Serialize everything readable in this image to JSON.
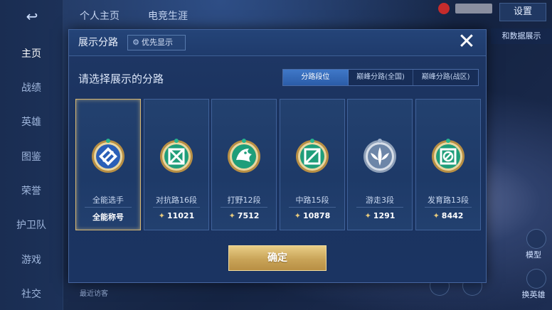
{
  "background": {
    "top_nav": [
      "个人主页",
      "电竞生涯"
    ],
    "settings_label": "设置",
    "right_peek_label": "和数据展示",
    "sidebar_items": [
      "主页",
      "战绩",
      "英雄",
      "图鉴",
      "荣誉",
      "护卫队",
      "游戏",
      "社交"
    ],
    "bottom_right_labels": [
      "模型",
      "换英雄"
    ],
    "recent_visitors_label": "最近访客"
  },
  "modal": {
    "title": "展示分路",
    "priority_label": "优先显示",
    "subtitle": "请选择展示的分路",
    "tabs": [
      {
        "label": "分路段位",
        "active": true
      },
      {
        "label": "巅峰分路(全国)",
        "active": false
      },
      {
        "label": "巅峰分路(战区)",
        "active": false
      }
    ],
    "cards": [
      {
        "name": "全能选手",
        "value": "全能称号",
        "icon": "all-round-emblem",
        "selected": true
      },
      {
        "name": "对抗路16段",
        "value": "11021",
        "icon": "clash-lane-emblem",
        "selected": false
      },
      {
        "name": "打野12段",
        "value": "7512",
        "icon": "jungle-emblem",
        "selected": false
      },
      {
        "name": "中路15段",
        "value": "10878",
        "icon": "mid-lane-emblem",
        "selected": false
      },
      {
        "name": "游走3段",
        "value": "1291",
        "icon": "roam-emblem",
        "selected": false
      },
      {
        "name": "发育路13段",
        "value": "8442",
        "icon": "farm-lane-emblem",
        "selected": false
      }
    ],
    "confirm_label": "确定"
  },
  "colors": {
    "gold": "#d8b873",
    "teal": "#27b58e",
    "accent_blue": "#3f78c8"
  }
}
